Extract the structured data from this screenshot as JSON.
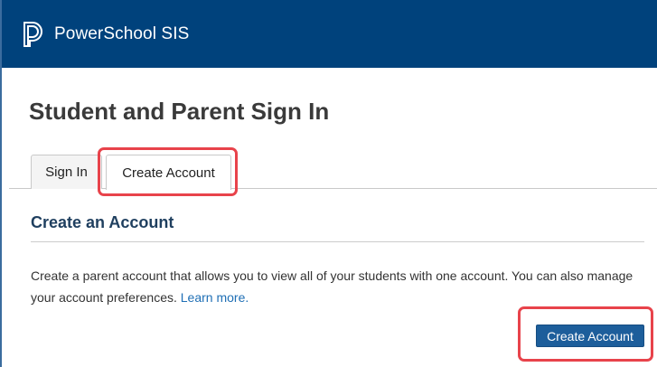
{
  "header": {
    "brand": "PowerSchool SIS",
    "logo_icon": "powerschool-logo-icon",
    "background": "#00427c"
  },
  "page": {
    "title": "Student and Parent Sign In"
  },
  "tabs": [
    {
      "label": "Sign In",
      "active": false
    },
    {
      "label": "Create Account",
      "active": true
    }
  ],
  "section": {
    "title": "Create an Account",
    "description": "Create a parent account that allows you to view all of your students with one account. You can also manage your account preferences. ",
    "learn_more": "Learn more."
  },
  "actions": {
    "create_account_label": "Create Account",
    "button_color": "#1d5e9b"
  },
  "highlight_color": "#e8434b"
}
